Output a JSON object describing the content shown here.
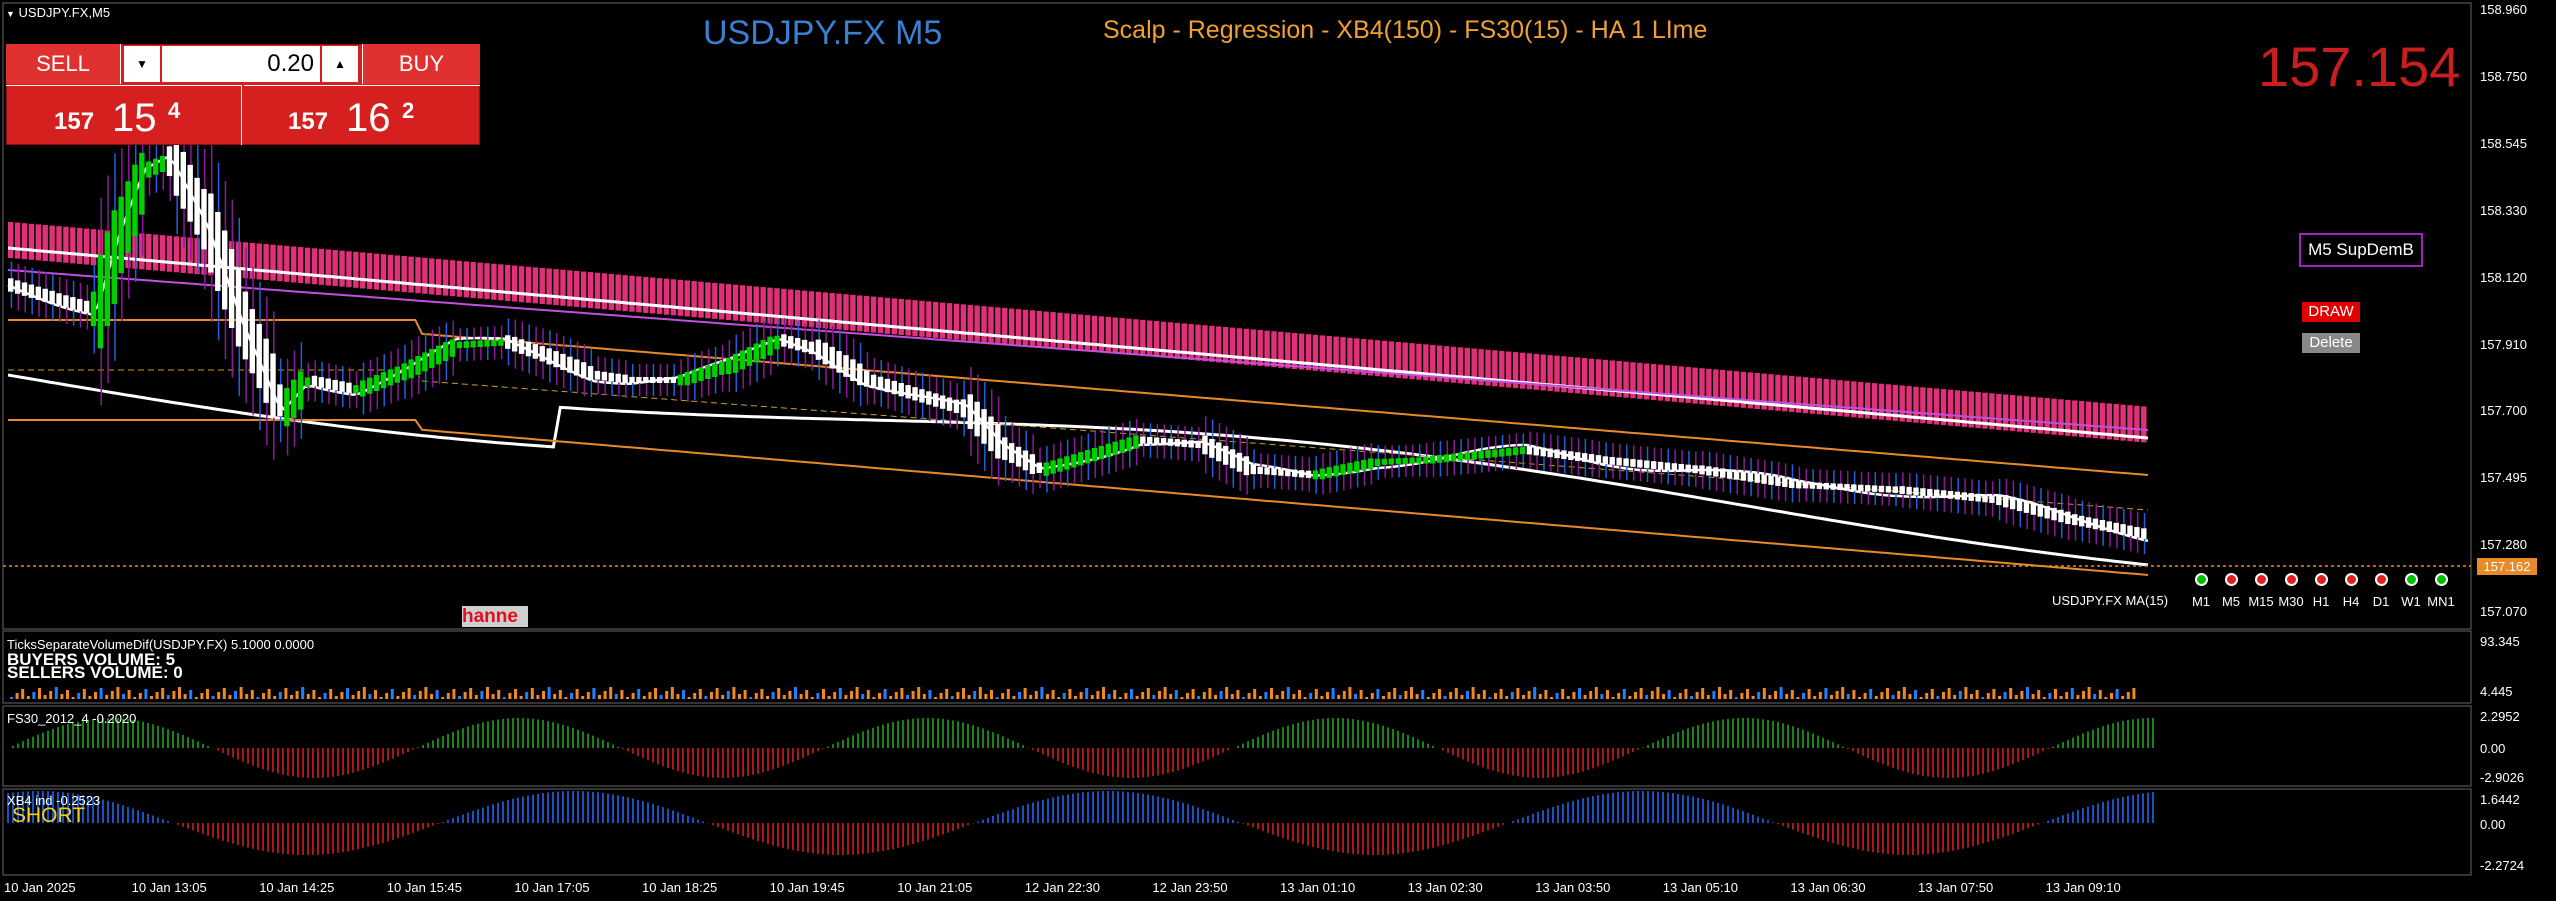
{
  "window": {
    "caption": "USDJPY.FX,M5"
  },
  "header": {
    "symbol_title": "USDJPY.FX M5",
    "strategy_title": "Scalp - Regression - XB4(150) - FS30(15) - HA  1 LIme",
    "current_price_big": "157.154"
  },
  "trade_panel": {
    "sell_label": "SELL",
    "buy_label": "BUY",
    "lot_value": "0.20",
    "sell_price": {
      "prefix": "157",
      "big": "15",
      "sup": "4"
    },
    "buy_price": {
      "prefix": "157",
      "big": "16",
      "sup": "2"
    }
  },
  "price_axis": {
    "ticks": [
      "158.960",
      "158.750",
      "158.545",
      "158.330",
      "158.120",
      "157.910",
      "157.700",
      "157.495",
      "157.280",
      "157.070"
    ],
    "current_marker": "157.162"
  },
  "time_axis": {
    "ticks": [
      "10 Jan 2025",
      "10 Jan 13:05",
      "10 Jan 14:25",
      "10 Jan 15:45",
      "10 Jan 17:05",
      "10 Jan 18:25",
      "10 Jan 19:45",
      "10 Jan 21:05",
      "12 Jan 22:30",
      "12 Jan 23:50",
      "13 Jan 01:10",
      "13 Jan 02:30",
      "13 Jan 03:50",
      "13 Jan 05:10",
      "13 Jan 06:30",
      "13 Jan 07:50",
      "13 Jan 09:10"
    ]
  },
  "side_widgets": {
    "supdem_label": "M5 SupDemB",
    "draw_label": "DRAW",
    "delete_label": "Delete",
    "watermark": "hanne"
  },
  "ma_label": "USDJPY.FX MA(15)",
  "timeframes": [
    "M1",
    "M5",
    "M15",
    "M30",
    "H1",
    "H4",
    "D1",
    "W1",
    "MN1"
  ],
  "timeframe_status": [
    "#00c000",
    "#e02020",
    "#e02020",
    "#e02020",
    "#e02020",
    "#e02020",
    "#e02020",
    "#00c000",
    "#00c000"
  ],
  "volume_panel": {
    "title": "TicksSeparateVolumeDif(USDJPY.FX) 5.1000 0.0000",
    "buyers": "BUYERS VOLUME: 5",
    "sellers": "SELLERS VOLUME: 0",
    "scale_top": "93.345",
    "scale_bottom": "4.445"
  },
  "fs30_panel": {
    "title": "FS30_2012_4 -0.2020",
    "scale": [
      "2.2952",
      "0.00",
      "-2.9026"
    ]
  },
  "xb4_panel": {
    "title": "XB4 ind -0.2523",
    "signal": "SHORT",
    "scale": [
      "1.6442",
      "0.00",
      "-2.2724"
    ]
  },
  "colors": {
    "bull": "#00d000",
    "bear": "#ffffff",
    "cloud": "#e0307a",
    "envelope": "#ffffff",
    "ma_violet": "#c050e0",
    "regression": "#e88a2a",
    "sell_bg": "#d62020",
    "buy_bg": "#d62020",
    "strategy_title": "#f0a030",
    "symbol_title": "#3a7fd0",
    "big_price": "#c81e1e"
  }
}
